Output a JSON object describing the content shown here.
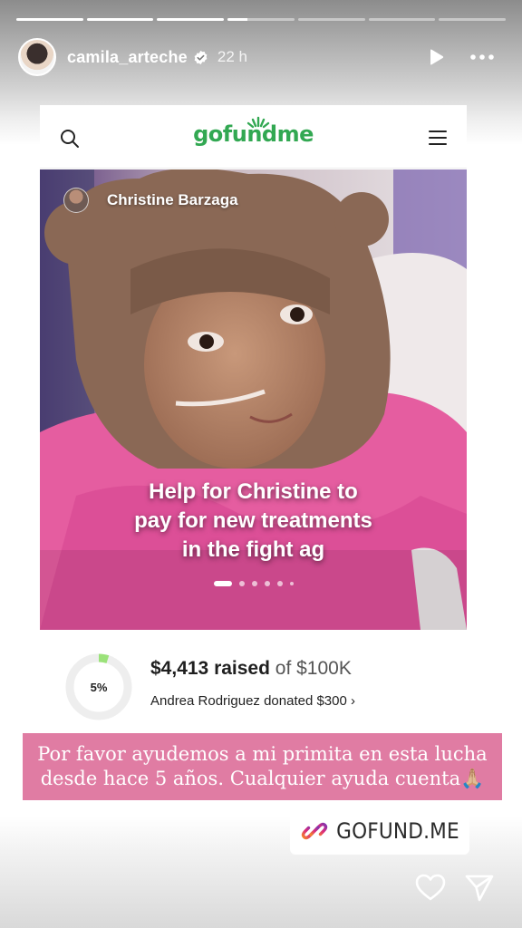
{
  "story": {
    "progress": {
      "segments": 7,
      "current_index": 3,
      "current_fill": 0.3
    },
    "header": {
      "username": "camila_arteche",
      "verified_icon": "verified-badge-icon",
      "timestamp": "22 h",
      "play_icon": "play-icon",
      "more_icon": "more-options-icon"
    },
    "gofundme": {
      "logo_text": "gofundme",
      "search_icon": "search-icon",
      "menu_icon": "hamburger-menu-icon",
      "organizer_name": "Christine Barzaga",
      "headline_lines": [
        "Help for Christine to",
        "pay for new treatments",
        "in the fight ag"
      ],
      "carousel": {
        "count": 6,
        "active": 0
      },
      "progress_percent_label": "5%",
      "progress_fraction": 0.05,
      "raised_amount": "$4,413 raised",
      "goal_text": "of $100K",
      "recent_donation": "Andrea Rodriguez donated $300",
      "donation_chevron": "›",
      "brand_green": "#32a852"
    },
    "caption": {
      "line1": "Por favor ayudemos a mi primita en esta lucha",
      "line2": "desde hace 5 años. Cualquier ayuda cuenta🙏🏼",
      "background": "#e07ca3"
    },
    "link_sticker": {
      "text": "GOFUND.ME",
      "icon": "link-icon"
    },
    "actions": {
      "like_icon": "heart-icon",
      "share_icon": "send-icon"
    }
  }
}
